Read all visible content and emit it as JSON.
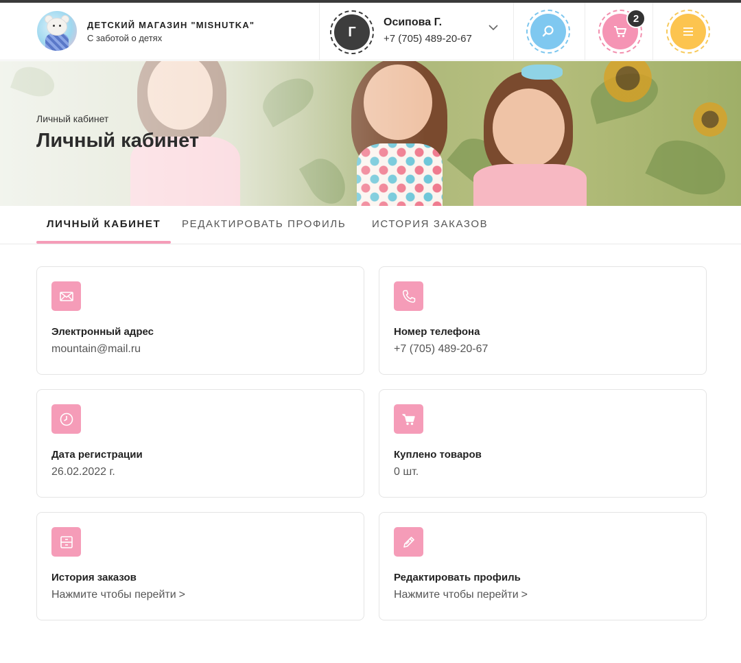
{
  "header": {
    "brand_title": "ДЕТСКИЙ МАГАЗИН \"MISHUTKA\"",
    "brand_subtitle": "С заботой о детях",
    "user": {
      "initial": "Г",
      "name": "Осипова Г.",
      "phone": "+7 (705) 489-20-67"
    },
    "cart_count": "2",
    "icons": {
      "search": "search-icon",
      "cart": "cart-icon",
      "menu": "menu-icon",
      "dropdown": "chevron-down-icon"
    },
    "colors": {
      "search": "#7fc8f0",
      "cart": "#f594b4",
      "menu": "#fcc44f",
      "accent": "#f59cb8"
    }
  },
  "banner": {
    "breadcrumb": "Личный кабинет",
    "title": "Личный кабинет"
  },
  "tabs": [
    {
      "label": "ЛИЧНЫЙ КАБИНЕТ",
      "active": true
    },
    {
      "label": "РЕДАКТИРОВАТЬ ПРОФИЛЬ",
      "active": false
    },
    {
      "label": "ИСТОРИЯ ЗАКАЗОВ",
      "active": false
    }
  ],
  "cards": [
    {
      "icon": "mail-icon",
      "title": "Электронный адрес",
      "value": "mountain@mail.ru"
    },
    {
      "icon": "phone-icon",
      "title": "Номер телефона",
      "value": "+7 (705) 489-20-67"
    },
    {
      "icon": "clock-icon",
      "title": "Дата регистрации",
      "value": "26.02.2022 г."
    },
    {
      "icon": "cart-icon",
      "title": "Куплено товаров",
      "value": "0 шт."
    },
    {
      "icon": "archive-icon",
      "title": "История заказов",
      "value": "Нажмите чтобы перейти",
      "arrow": ">"
    },
    {
      "icon": "pencil-icon",
      "title": "Редактировать профиль",
      "value": "Нажмите чтобы перейти",
      "arrow": ">"
    }
  ]
}
